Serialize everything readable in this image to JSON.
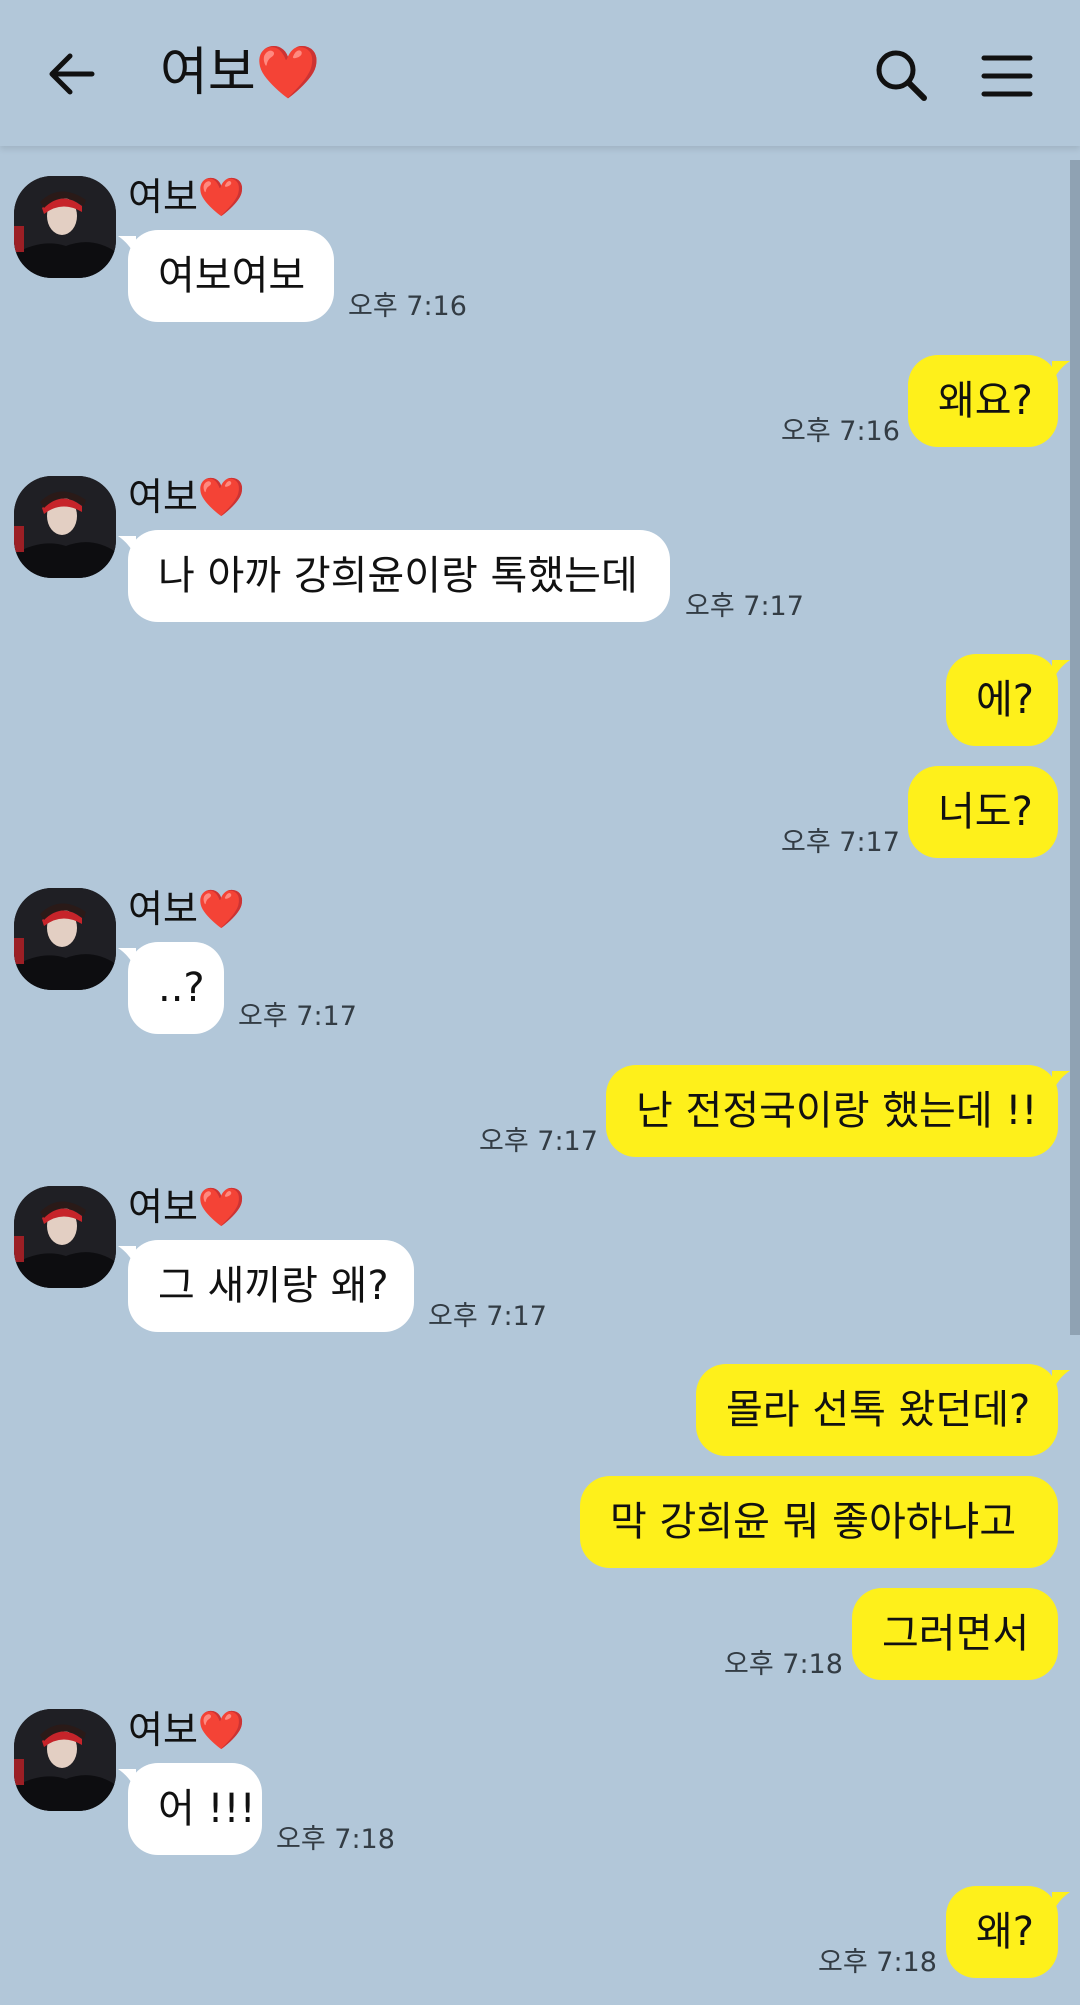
{
  "header": {
    "title": "여보❤️",
    "back_icon": "arrow-left-icon",
    "search_icon": "search-icon",
    "menu_icon": "menu-icon"
  },
  "colors": {
    "background": "#b2c7d9",
    "incoming_bubble": "#ffffff",
    "outgoing_bubble": "#fef01b"
  },
  "messages": [
    {
      "sender": "여보❤️",
      "text": "여보여보",
      "time": "오후 7:16"
    },
    {
      "text": "왜요?",
      "time": "오후 7:16"
    },
    {
      "sender": "여보❤️",
      "text": "나 아까 강희윤이랑 톡했는데",
      "time": "오후 7:17"
    },
    {
      "text": "에?"
    },
    {
      "text": "너도?",
      "time": "오후 7:17"
    },
    {
      "sender": "여보❤️",
      "text": "..?",
      "time": "오후 7:17"
    },
    {
      "text": "난 전정국이랑 했는데 !!",
      "time": "오후 7:17"
    },
    {
      "sender": "여보❤️",
      "text": "그 새끼랑 왜?",
      "time": "오후 7:17"
    },
    {
      "text": "몰라 선톡 왔던데?"
    },
    {
      "text": "막 강희윤 뭐 좋아하냐고"
    },
    {
      "text": "그러면서",
      "time": "오후 7:18"
    },
    {
      "sender": "여보❤️",
      "text": "어 !!!",
      "time": "오후 7:18"
    },
    {
      "text": "왜?",
      "time": "오후 7:18"
    }
  ]
}
